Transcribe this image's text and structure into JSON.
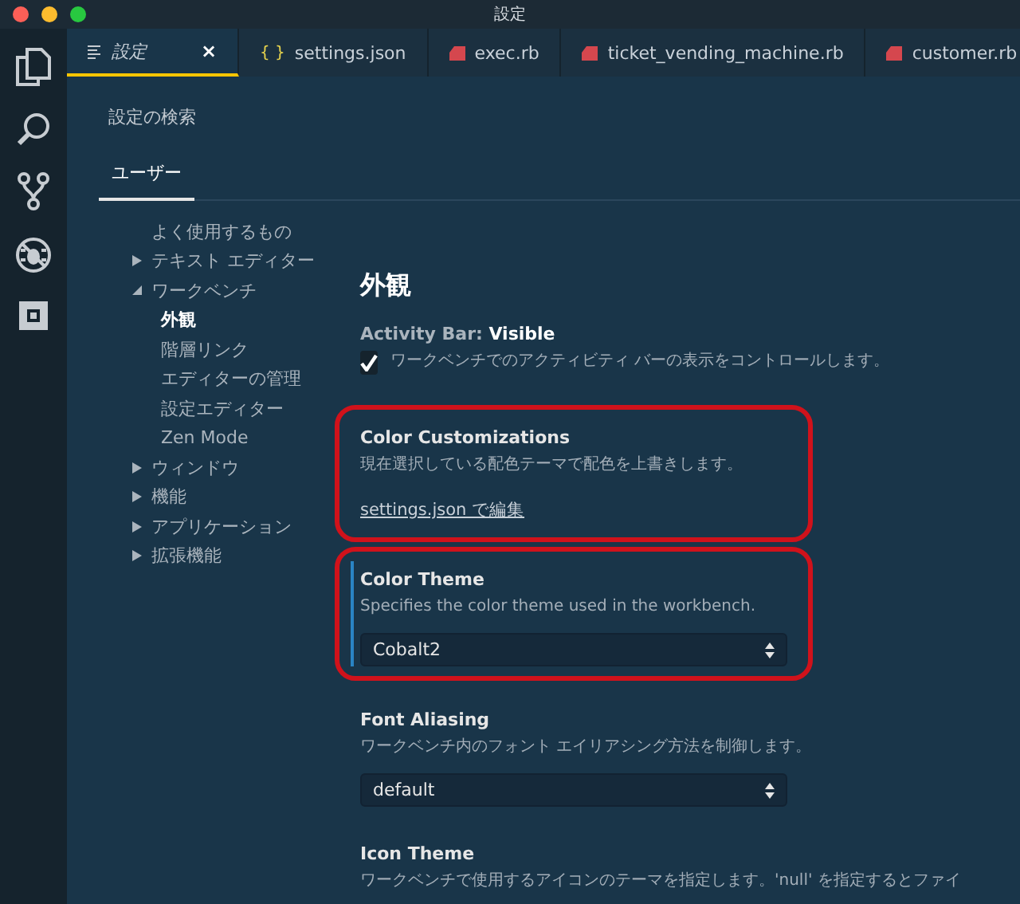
{
  "window": {
    "title": "設定"
  },
  "tabs": [
    {
      "label": "設定",
      "kind": "settings",
      "selected": true,
      "close": "×"
    },
    {
      "label": "settings.json",
      "kind": "json",
      "icon": "{ }",
      "selected": false
    },
    {
      "label": "exec.rb",
      "kind": "ruby",
      "selected": false
    },
    {
      "label": "ticket_vending_machine.rb",
      "kind": "ruby",
      "selected": false
    },
    {
      "label": "customer.rb",
      "kind": "ruby",
      "selected": false
    }
  ],
  "search": {
    "placeholder": "設定の検索"
  },
  "scope_tabs": [
    {
      "label": "ユーザー",
      "selected": true
    }
  ],
  "toc": [
    {
      "label": "よく使用するもの",
      "selected": false
    },
    {
      "label": "テキスト エディター",
      "selected": false,
      "expanded": false
    },
    {
      "label": "ワークベンチ",
      "selected": false,
      "expanded": true,
      "children": [
        {
          "label": "外観",
          "selected": true
        },
        {
          "label": "階層リンク",
          "selected": false
        },
        {
          "label": "エディターの管理",
          "selected": false
        },
        {
          "label": "設定エディター",
          "selected": false
        },
        {
          "label": "Zen Mode",
          "selected": false
        }
      ]
    },
    {
      "label": "ウィンドウ",
      "selected": false,
      "expanded": false
    },
    {
      "label": "機能",
      "selected": false,
      "expanded": false
    },
    {
      "label": "アプリケーション",
      "selected": false,
      "expanded": false
    },
    {
      "label": "拡張機能",
      "selected": false,
      "expanded": false
    }
  ],
  "section": {
    "title": "外観",
    "settings": [
      {
        "kind": "checkbox",
        "title": "Activity Bar: **Visible**",
        "checked": true,
        "description": "ワークベンチでのアクティビティ バーの表示をコントロールします。",
        "highlighted": false
      },
      {
        "kind": "link",
        "title": "Color Customizations",
        "description": "現在選択している配色テーマで配色を上書きします。",
        "link": "settings.json で編集",
        "highlighted": true
      },
      {
        "kind": "select",
        "title": "Color Theme",
        "description": "Specifies the color theme used in the workbench.",
        "value": "Cobalt2",
        "focused": true,
        "highlighted": true
      },
      {
        "kind": "select",
        "title": "Font Aliasing",
        "description": "ワークベンチ内のフォント エイリアシング方法を制御します。",
        "value": "default",
        "focused": false,
        "highlighted": false
      },
      {
        "kind": "text",
        "title": "Icon Theme",
        "description": "ワークベンチで使用するアイコンのテーマを指定します。'null' を指定するとファイ",
        "highlighted": false
      }
    ]
  }
}
